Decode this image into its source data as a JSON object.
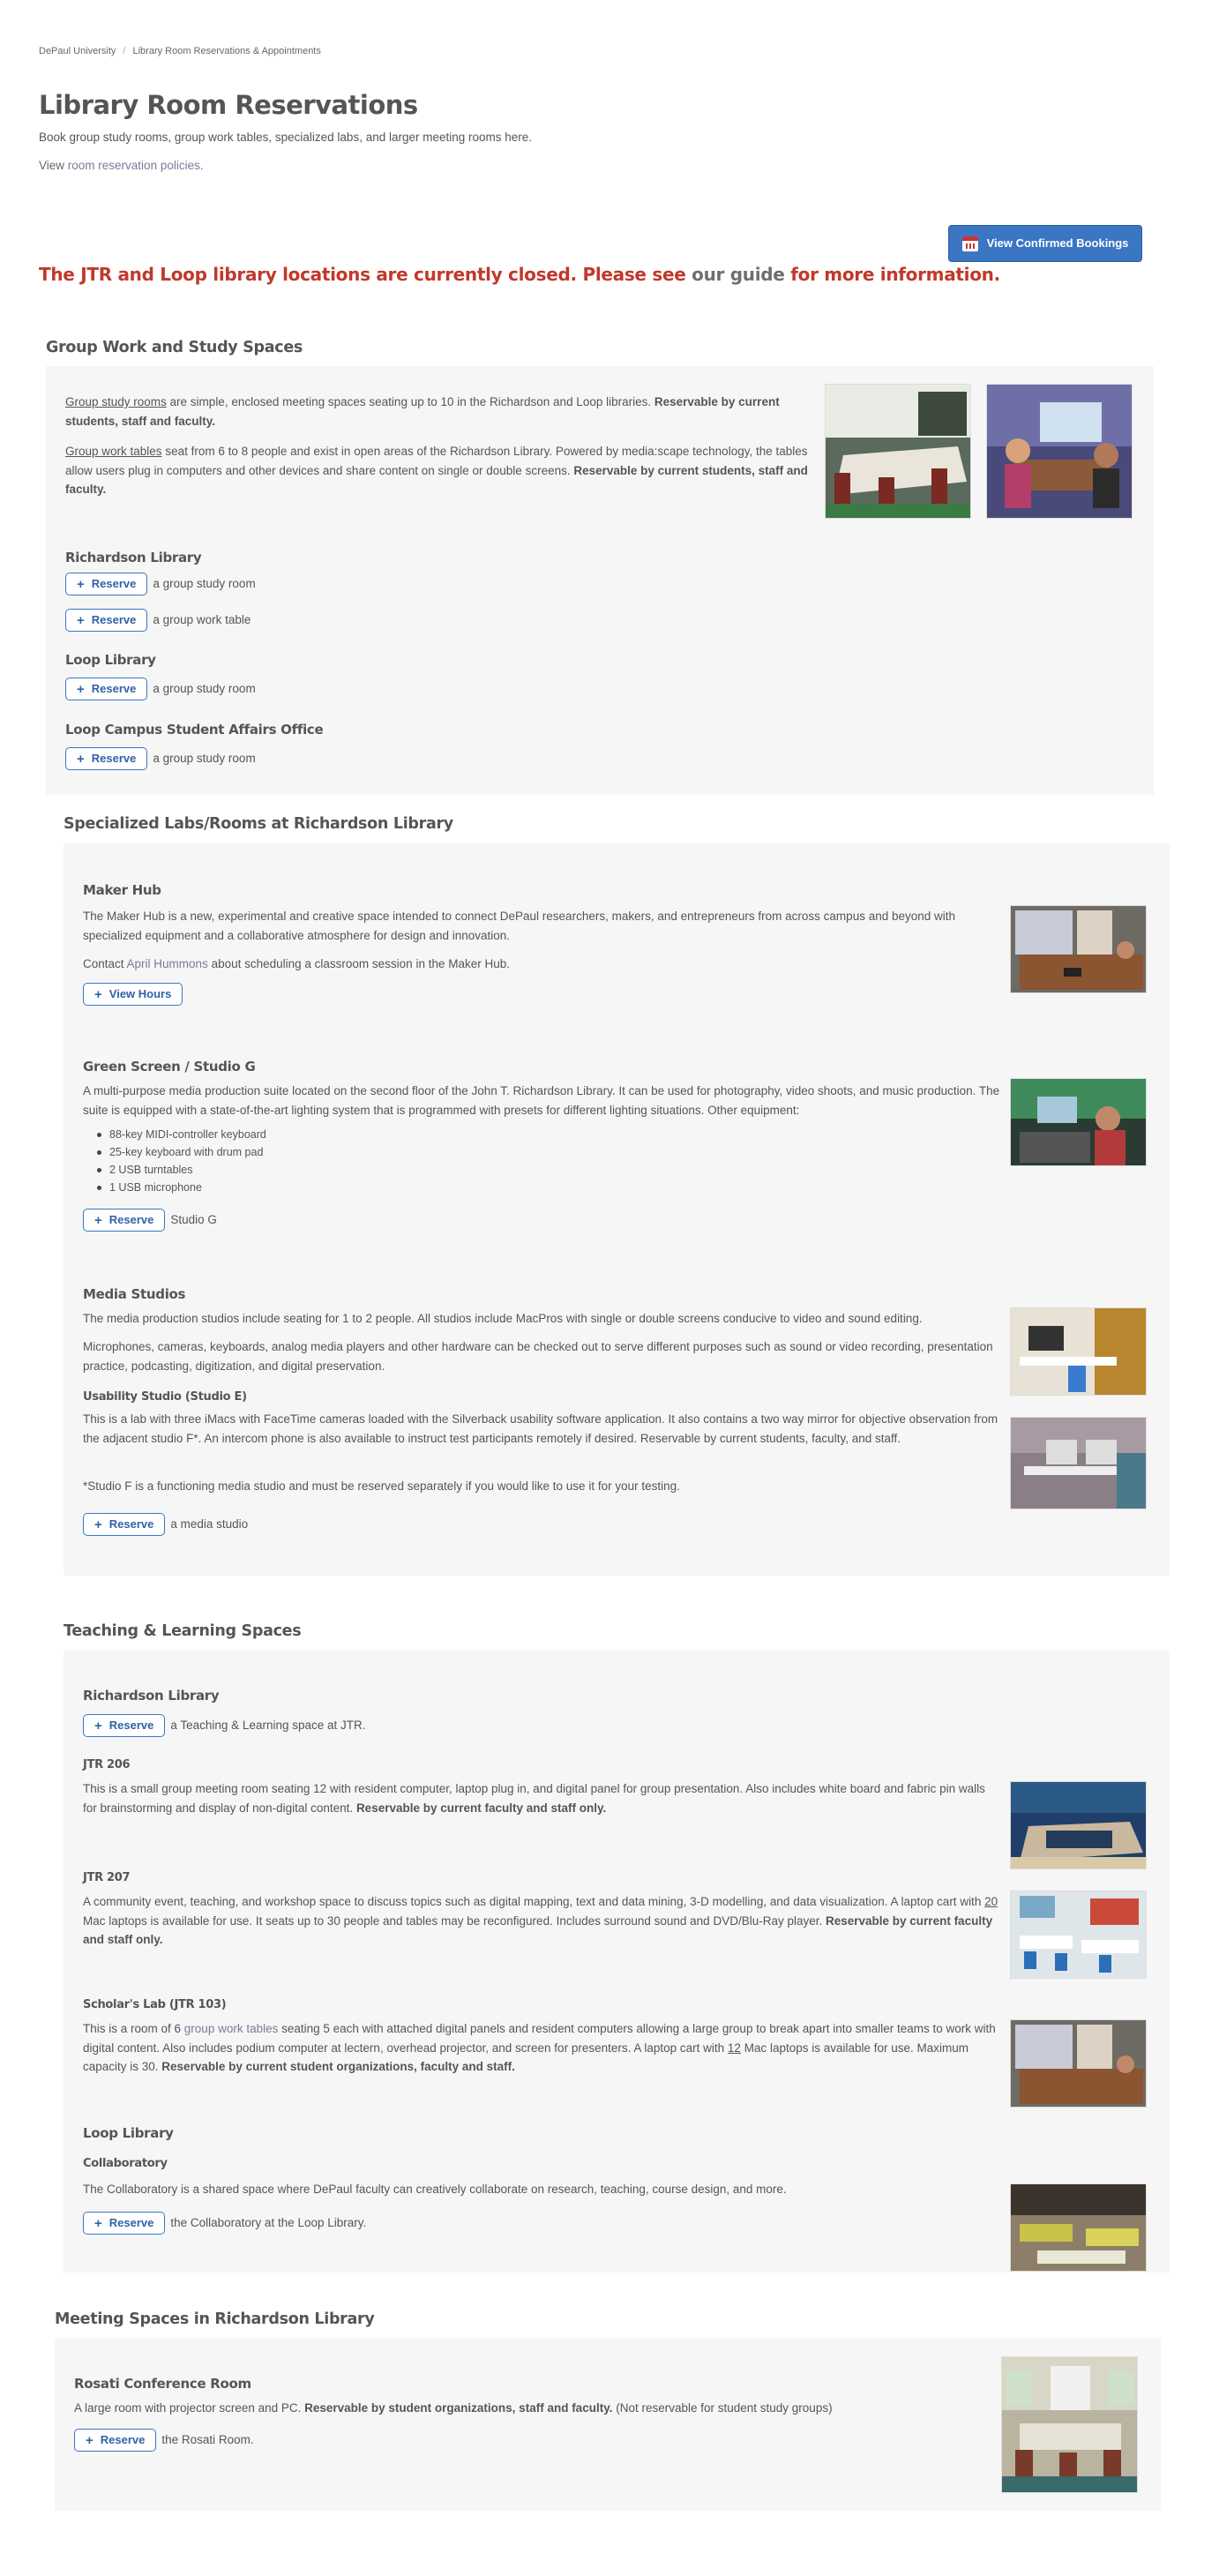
{
  "breadcrumb": {
    "home": "DePaul University",
    "current": "Library Room Reservations & Appointments"
  },
  "page": {
    "title": "Library Room Reservations",
    "subtitle": "Book group study rooms, group work tables, specialized labs, and larger meeting rooms here.",
    "policy_prefix": "View ",
    "policy_link": "room reservation policies",
    "policy_suffix": "."
  },
  "confirm_button": "View Confirmed Bookings",
  "alert": {
    "part1": "The JTR and Loop library locations are currently closed. Please see ",
    "link": "our guide",
    "part2": " for more information."
  },
  "reserve_label": "Reserve",
  "group": {
    "title": "Group Work and Study Spaces",
    "p1_link": "Group study rooms",
    "p1_text": " are simple, enclosed meeting spaces seating up to 10 in the Richardson and Loop libraries. ",
    "p1_bold": "Reservable by current students, staff and faculty.",
    "p2_link": "Group work tables",
    "p2_text": " seat from 6 to 8 people and exist in open areas of the Richardson Library.  Powered by media:scape technology, the tables allow users plug in computers and other devices and share content on single or double screens. ",
    "p2_bold": "Reservable by current students, staff and faculty.",
    "richardson": "Richardson Library",
    "study_room": "a group study room",
    "work_table": "a group work table",
    "loop": "Loop Library",
    "loop_campus": "Loop Campus Student Affairs Office"
  },
  "specialized": {
    "title": "Specialized Labs/Rooms at Richardson Library",
    "maker_title": "Maker Hub",
    "maker_text": "The Maker Hub is a new, experimental and creative space intended to connect DePaul researchers, makers, and entrepreneurs from across campus and beyond with specialized equipment and a collaborative atmosphere for design and innovation.",
    "maker_contact_prefix": "Contact ",
    "maker_contact_name": "April Hummons",
    "maker_contact_suffix": " about scheduling a classroom session in the Maker Hub.",
    "view_hours": "View Hours",
    "green_title": "Green Screen / Studio G",
    "green_text": "A multi-purpose media production suite located on the second floor of the John T. Richardson Library. It can be used for photography, video shoots, and music production. The suite is equipped with a state-of-the-art lighting system that is programmed with presets for different lighting situations. Other equipment:",
    "equipment": [
      "88-key MIDI-controller keyboard",
      "25-key keyboard with drum pad",
      "2 USB turntables",
      "1 USB microphone"
    ],
    "studio_g": "Studio G",
    "media_title": "Media Studios",
    "media_text1": "The media production studios include seating for 1 to 2 people. All studios include MacPros with single or double screens conducive to video and sound editing.",
    "media_text2": "Microphones, cameras, keyboards, analog media players and other hardware can be checked out to serve different purposes such as sound or video recording, presentation practice, podcasting, digitization, and digital preservation.",
    "usability_title": "Usability Studio (Studio E)",
    "usability_text": "This is a lab with three iMacs with FaceTime cameras loaded with the Silverback usability software application. It also contains a two way mirror for objective observation from the adjacent studio F*. An intercom phone is also available to instruct test participants remotely if desired. Reservable by current students, faculty, and staff.",
    "studio_f_note": "*Studio F is a functioning media studio and must be reserved separately if you would like to use it for your testing.",
    "media_studio": "a media studio"
  },
  "teaching": {
    "title": "Teaching & Learning Spaces",
    "richardson": "Richardson Library",
    "tl_space": "a Teaching & Learning space at JTR.",
    "jtr206_title": "JTR 206",
    "jtr206_text": "This is a small group meeting room seating 12 with resident computer, laptop plug in, and digital panel for group presentation. Also includes white board and fabric pin walls for brainstorming and display of non-digital content.  ",
    "jtr206_bold": "Reservable by current faculty and staff only.",
    "jtr207_title": "JTR 207",
    "jtr207_text1": "A community event, teaching, and workshop space to discuss topics such as digital mapping, text and data mining, 3-D modelling, and data visualization. A laptop cart with ",
    "jtr207_num": "20",
    "jtr207_text2": " Mac laptops is available for use. It seats up to 30 people and tables may be reconfigured. Includes surround sound and DVD/Blu-Ray player. ",
    "jtr207_bold": "Reservable by current faculty and staff only.",
    "scholar_title": "Scholar's Lab (JTR 103)",
    "scholar_text1": "This is a room of 6 ",
    "scholar_link": "group work tables",
    "scholar_text2": " seating 5 each with attached digital panels and resident computers allowing a large group to break apart into smaller teams to work with digital content. Also includes podium computer at lectern, overhead projector, and screen for presenters.  A laptop cart with ",
    "scholar_num": "12",
    "scholar_text3": " Mac laptops is available for use. Maximum capacity is 30.  ",
    "scholar_bold": "Reservable by current student organizations, faculty and staff.",
    "loop": "Loop Library",
    "collab_title": "Collaboratory",
    "collab_text": "The Collaboratory is a shared space where DePaul faculty can creatively collaborate on research, teaching, course design, and more.",
    "collab_reserve": "the Collaboratory at the Loop Library."
  },
  "meeting": {
    "title": "Meeting Spaces in Richardson Library",
    "rosati_title": "Rosati Conference Room",
    "rosati_text": "A large room with projector screen and PC. ",
    "rosati_bold": "Reservable by student organizations, staff and faculty.",
    "rosati_note": " (Not reservable for student study groups)",
    "rosati_reserve": "the Rosati Room."
  },
  "colors": {
    "accent": "#3a76c4",
    "alert": "#c0392b",
    "panel": "#f6f6f6"
  }
}
